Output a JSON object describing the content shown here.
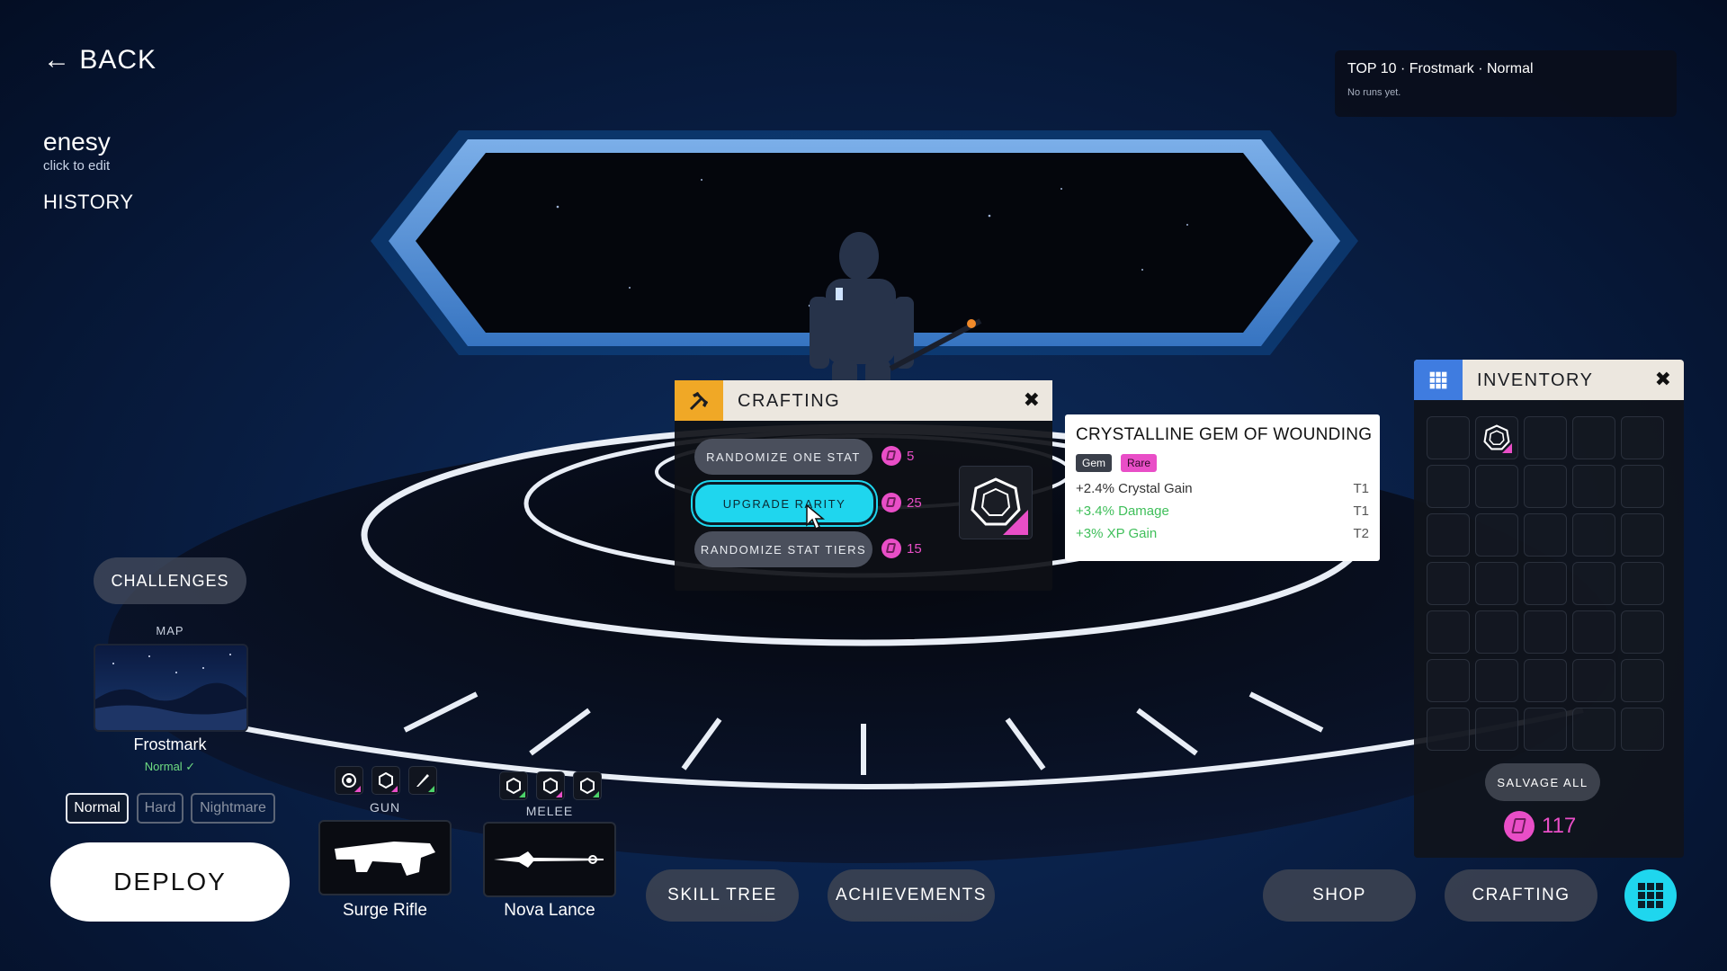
{
  "nav": {
    "back_label": "← BACK"
  },
  "player": {
    "name": "enesy",
    "edit_hint": "click to edit",
    "history_label": "HISTORY"
  },
  "leaderboard": {
    "title": "TOP 10 · Frostmark · Normal",
    "status": "No runs yet."
  },
  "challenges": {
    "label": "CHALLENGES"
  },
  "map": {
    "section_label": "MAP",
    "name": "Frostmark",
    "difficulty_status": "Normal ✓"
  },
  "difficulty": {
    "options": [
      "Normal",
      "Hard",
      "Nightmare"
    ],
    "selected": "Normal"
  },
  "deploy": {
    "label": "DEPLOY"
  },
  "loadout": {
    "gun": {
      "label": "GUN",
      "weapon_name": "Surge Rifle",
      "mods": [
        "cog-mod-icon",
        "gem-mod-icon",
        "blade-mod-icon"
      ]
    },
    "melee": {
      "label": "MELEE",
      "weapon_name": "Nova Lance",
      "mods": [
        "gem-mod-icon",
        "gem-mod-icon",
        "gem-mod-icon"
      ]
    }
  },
  "bottom_nav": {
    "skill_tree": "SKILL TREE",
    "achievements": "ACHIEVEMENTS",
    "shop": "SHOP",
    "crafting": "CRAFTING"
  },
  "crafting": {
    "title": "CRAFTING",
    "actions": [
      {
        "label": "RANDOMIZE ONE STAT",
        "cost": "5"
      },
      {
        "label": "UPGRADE RARITY",
        "cost": "25"
      },
      {
        "label": "RANDOMIZE STAT TIERS",
        "cost": "15"
      }
    ],
    "highlighted_action": "UPGRADE RARITY"
  },
  "item": {
    "name": "CRYSTALLINE GEM OF WOUNDING",
    "type_tag": "Gem",
    "rarity_tag": "Rare",
    "stats": [
      {
        "text": "+2.4% Crystal Gain",
        "tier": "T1",
        "color": "#333333"
      },
      {
        "text": "+3.4% Damage",
        "tier": "T1",
        "color": "#3fbf5a"
      },
      {
        "text": "+3% XP Gain",
        "tier": "T2",
        "color": "#3fbf5a"
      }
    ]
  },
  "inventory": {
    "title": "INVENTORY",
    "rows": 7,
    "cols": 5,
    "filled_slot": 1,
    "salvage_label": "SALVAGE ALL",
    "crystal_count": "117"
  },
  "colors": {
    "accent_cyan": "#1fd6ee",
    "crystal_pink": "#e94ec7",
    "crafting_orange": "#f0a826",
    "inventory_blue": "#3f7ce0",
    "stat_green": "#3fbf5a"
  }
}
